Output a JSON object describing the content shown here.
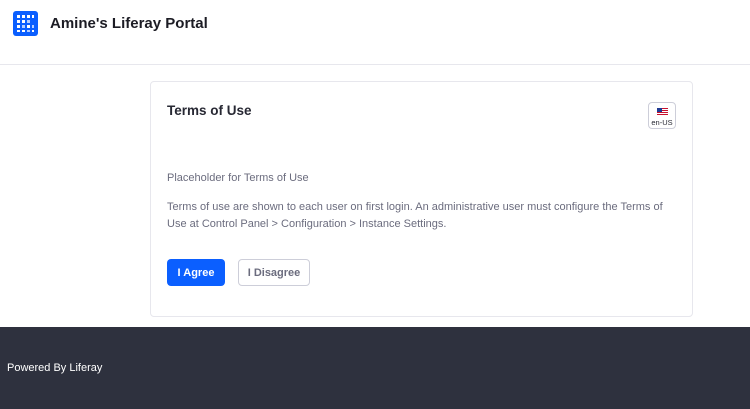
{
  "header": {
    "site_title": "Amine's Liferay Portal",
    "logo_icon": "liferay-logo-icon",
    "brand_color": "#0b5fff"
  },
  "terms": {
    "title": "Terms of Use",
    "language_code": "en-US",
    "language_icon": "us-flag-icon",
    "placeholder": "Placeholder for Terms of Use",
    "description": "Terms of use are shown to each user on first login. An administrative user must configure the Terms of Use at Control Panel > Configuration > Instance Settings.",
    "agree_label": "I Agree",
    "disagree_label": "I Disagree"
  },
  "footer": {
    "text": "Powered By Liferay",
    "background_color": "#2e313e"
  }
}
